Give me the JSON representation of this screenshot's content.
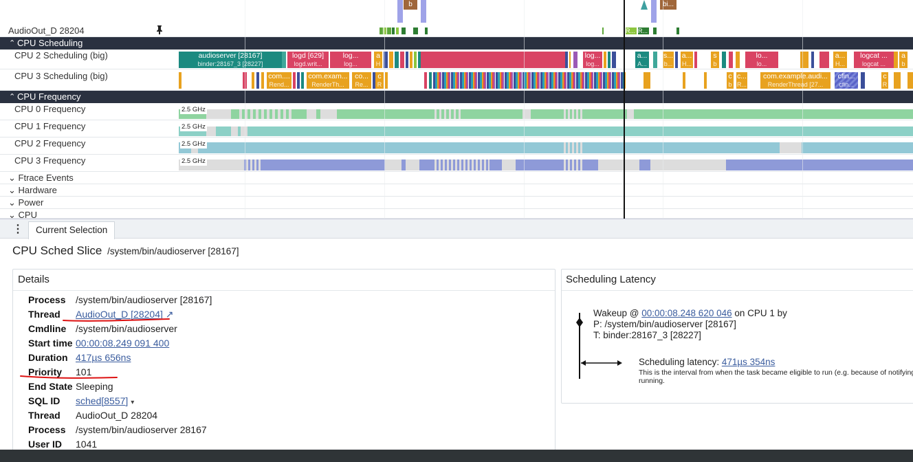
{
  "tracks": {
    "thread_track": {
      "label": "AudioOut_D 28204",
      "marker_labels": [
        "b",
        "bi..."
      ]
    },
    "groups": {
      "cpu_scheduling": "CPU Scheduling",
      "cpu_frequency": "CPU Frequency"
    },
    "sched_tracks": [
      "CPU 2 Scheduling (big)",
      "CPU 3 Scheduling (big)"
    ],
    "freq_tracks": [
      "CPU 0 Frequency",
      "CPU 1 Frequency",
      "CPU 2 Frequency",
      "CPU 3 Frequency"
    ],
    "freq_value_label": "2.5 GHz",
    "collapsed": [
      "Ftrace Events",
      "Hardware",
      "Power",
      "CPU"
    ],
    "cpu2_slices": [
      {
        "title": "audioserver [28167]",
        "sub": "binder:28167_3 [28227]"
      },
      {
        "title": "logd [629]",
        "sub": "logd.writ..."
      },
      {
        "title": "log...",
        "sub": "log..."
      },
      {
        "title": "a",
        "sub": "H"
      },
      {
        "title": "log...",
        "sub": "log..."
      },
      {
        "title": "a...",
        "sub": "A..."
      },
      {
        "title": "s...",
        "sub": "b..."
      },
      {
        "title": "a...",
        "sub": "H..."
      },
      {
        "title": "s",
        "sub": "b"
      },
      {
        "title": "lo...",
        "sub": "lo..."
      },
      {
        "title": "a...",
        "sub": "H..."
      },
      {
        "title": "logcat ...",
        "sub": "logcat ..."
      },
      {
        "title": "a",
        "sub": "b"
      }
    ],
    "cpu3_slices": [
      {
        "title": "com....",
        "sub": "Rend..."
      },
      {
        "title": "com.exam...",
        "sub": "RenderTh..."
      },
      {
        "title": "co...",
        "sub": "Re..."
      },
      {
        "title": "c",
        "sub": "R"
      },
      {
        "title": "com.example.audi...",
        "sub": "RenderThread [27..."
      },
      {
        "title": "cfin...",
        "sub": "cfin..."
      }
    ]
  },
  "tabs": {
    "menu_glyph": "⋮",
    "current_selection": "Current Selection"
  },
  "selection": {
    "title": "CPU Sched Slice",
    "subtitle": "/system/bin/audioserver [28167]"
  },
  "details": {
    "heading": "Details",
    "rows": [
      {
        "key": "Process",
        "value": "/system/bin/audioserver [28167]"
      },
      {
        "key": "Thread",
        "value": "AudioOut_D [28204]",
        "link": true,
        "suffix": "↗"
      },
      {
        "key": "Cmdline",
        "value": "/system/bin/audioserver"
      },
      {
        "key": "Start time",
        "value": "00:00:08.249 091 400",
        "link": true
      },
      {
        "key": "Duration",
        "value": "417µs 656ns",
        "link": true
      },
      {
        "key": "Priority",
        "value": "101"
      },
      {
        "key": "End State",
        "value": "Sleeping"
      },
      {
        "key": "SQL ID",
        "value": "sched[8557]",
        "link": true,
        "suffix": "▾"
      },
      {
        "key": "Thread",
        "value": "AudioOut_D 28204"
      },
      {
        "key": "Process",
        "value": "/system/bin/audioserver 28167"
      },
      {
        "key": "User ID",
        "value": "1041"
      }
    ]
  },
  "latency": {
    "heading": "Scheduling Latency",
    "wakeup_prefix": "Wakeup @ ",
    "wakeup_time": "00:00:08.248 620 046",
    "wakeup_suffix": " on CPU 1 by",
    "wakeup_process": "P: /system/bin/audioserver [28167]",
    "wakeup_thread": "T: binder:28167_3 [28227]",
    "latency_prefix": "Scheduling latency: ",
    "latency_value": "471µs 354ns",
    "description_1": "This is the interval from when the task became eligible to run (e.g. because of notifying",
    "description_2": "running."
  },
  "colors": {
    "header_dark": "#2a3140",
    "teal": "#1b8a80",
    "crimson": "#d94363",
    "orange": "#e8a21f",
    "freq_green": "#8fd4a0",
    "freq_teal": "#8cd0c6",
    "freq_blue": "#93c8d6",
    "freq_indigo": "#8e9ad8",
    "annotation_red": "#dd1111",
    "link": "#3a5c9e"
  }
}
